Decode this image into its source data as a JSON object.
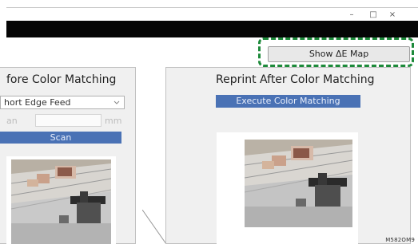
{
  "window_controls": {
    "minimize": "–",
    "maximize": "□",
    "close": "×"
  },
  "toolbar": {
    "show_map_label": "Show ΔE Map"
  },
  "left_panel": {
    "title": "fore Color Matching",
    "feed_select_value": "hort Edge Feed",
    "scan_label_partial": "an",
    "unit_label": "mm",
    "scan_button_label": "Scan"
  },
  "right_panel": {
    "title": "Reprint After Color Matching",
    "execute_button_label": "Execute Color Matching"
  },
  "footer": {
    "figure_code": "M582OM9"
  },
  "colors": {
    "highlight": "#1d8a3a",
    "button_blue": "#4a72b5",
    "panel_bg": "#f0f0f0"
  },
  "icons": {
    "select_chevron": "chevron-down-icon"
  }
}
